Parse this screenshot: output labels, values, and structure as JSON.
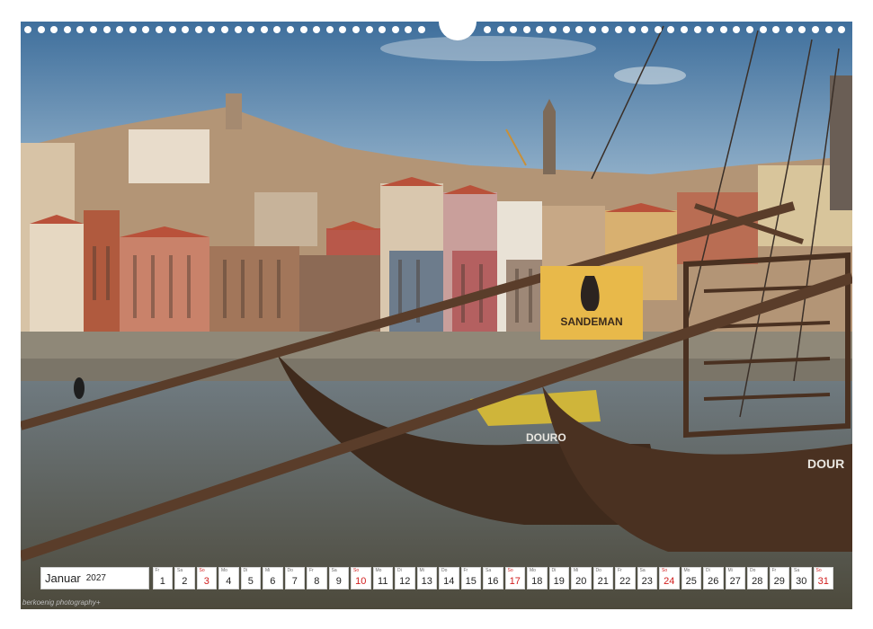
{
  "calendar": {
    "month": "Januar",
    "year": "2027",
    "weekday_labels": [
      "Fr",
      "Sa",
      "So",
      "Mo",
      "Di",
      "Mi",
      "Do"
    ],
    "days": [
      {
        "n": "1",
        "wd": "Fr",
        "sun": false
      },
      {
        "n": "2",
        "wd": "Sa",
        "sun": false
      },
      {
        "n": "3",
        "wd": "So",
        "sun": true
      },
      {
        "n": "4",
        "wd": "Mo",
        "sun": false
      },
      {
        "n": "5",
        "wd": "Di",
        "sun": false
      },
      {
        "n": "6",
        "wd": "Mi",
        "sun": false
      },
      {
        "n": "7",
        "wd": "Do",
        "sun": false
      },
      {
        "n": "8",
        "wd": "Fr",
        "sun": false
      },
      {
        "n": "9",
        "wd": "Sa",
        "sun": false
      },
      {
        "n": "10",
        "wd": "So",
        "sun": true
      },
      {
        "n": "11",
        "wd": "Mo",
        "sun": false
      },
      {
        "n": "12",
        "wd": "Di",
        "sun": false
      },
      {
        "n": "13",
        "wd": "Mi",
        "sun": false
      },
      {
        "n": "14",
        "wd": "Do",
        "sun": false
      },
      {
        "n": "15",
        "wd": "Fr",
        "sun": false
      },
      {
        "n": "16",
        "wd": "Sa",
        "sun": false
      },
      {
        "n": "17",
        "wd": "So",
        "sun": true
      },
      {
        "n": "18",
        "wd": "Mo",
        "sun": false
      },
      {
        "n": "19",
        "wd": "Di",
        "sun": false
      },
      {
        "n": "20",
        "wd": "Mi",
        "sun": false
      },
      {
        "n": "21",
        "wd": "Do",
        "sun": false
      },
      {
        "n": "22",
        "wd": "Fr",
        "sun": false
      },
      {
        "n": "23",
        "wd": "Sa",
        "sun": false
      },
      {
        "n": "24",
        "wd": "So",
        "sun": true
      },
      {
        "n": "25",
        "wd": "Mo",
        "sun": false
      },
      {
        "n": "26",
        "wd": "Di",
        "sun": false
      },
      {
        "n": "27",
        "wd": "Mi",
        "sun": false
      },
      {
        "n": "28",
        "wd": "Do",
        "sun": false
      },
      {
        "n": "29",
        "wd": "Fr",
        "sun": false
      },
      {
        "n": "30",
        "wd": "Sa",
        "sun": false
      },
      {
        "n": "31",
        "wd": "So",
        "sun": true
      }
    ]
  },
  "photo": {
    "banner_text": "SANDEMAN",
    "boat_name_1": "DOURO",
    "boat_name_2": "DOUR"
  },
  "credit": "berkoenig photography+",
  "colors": {
    "sunday": "#d11d1d",
    "sky": "#5b86ad",
    "river": "#5a5a4c",
    "hull": "#3f2a1c",
    "banner": "#e8b94a"
  }
}
